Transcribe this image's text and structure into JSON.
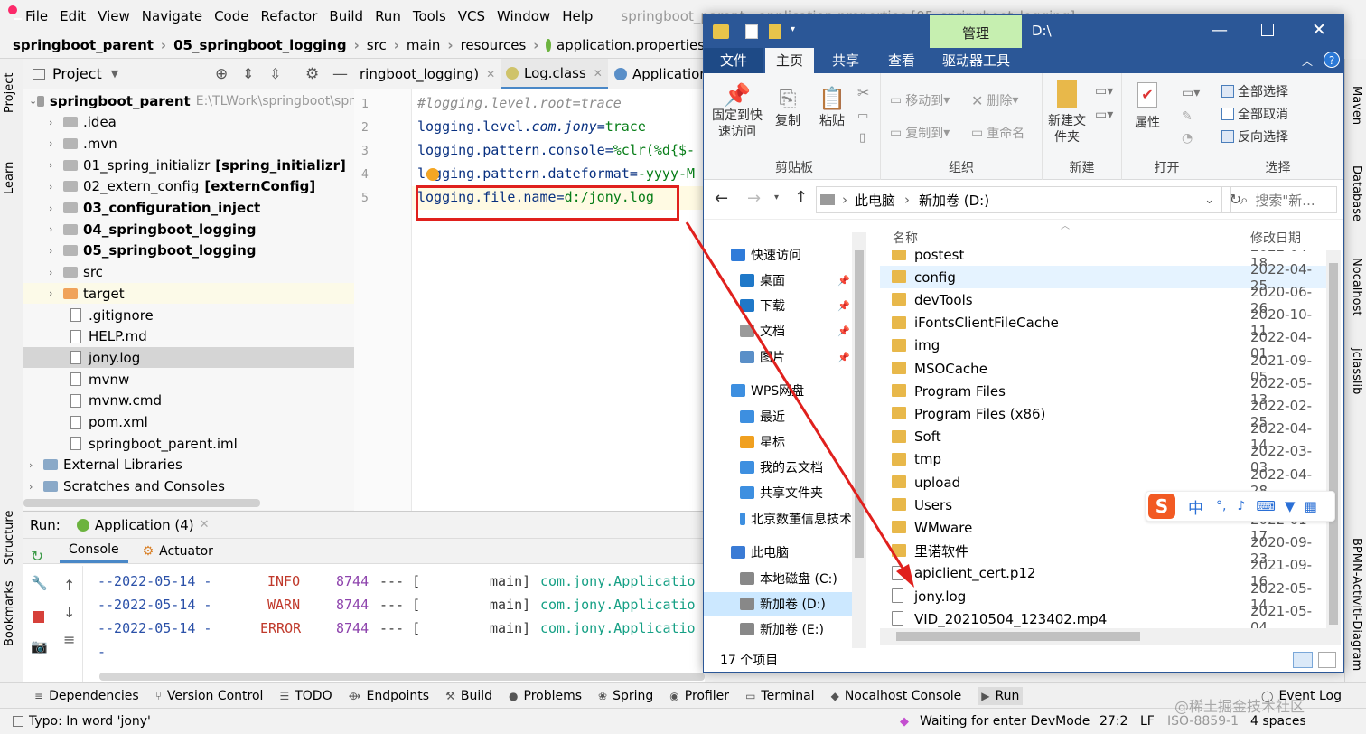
{
  "ide": {
    "menu": [
      "File",
      "Edit",
      "View",
      "Navigate",
      "Code",
      "Refactor",
      "Build",
      "Run",
      "Tools",
      "VCS",
      "Window",
      "Help"
    ],
    "window_title": "springboot_parent - application.properties [05_springboot_logging]",
    "breadcrumb": [
      "springboot_parent",
      "05_springboot_logging",
      "src",
      "main",
      "resources",
      "application.properties"
    ],
    "left_strip": [
      "Project",
      "Learn",
      "Structure",
      "Bookmarks"
    ],
    "right_strip": [
      "Maven",
      "Database",
      "Nocalhost",
      "jclasslib",
      "BPMN-Activiti-Diagram"
    ],
    "project_header": "Project",
    "tree": [
      {
        "label": "springboot_parent",
        "suffix": "E:\\TLWork\\springboot\\spr",
        "indent": 0,
        "bold": true,
        "type": "module",
        "open": true
      },
      {
        "label": ".idea",
        "indent": 1,
        "type": "folder"
      },
      {
        "label": ".mvn",
        "indent": 1,
        "type": "folder"
      },
      {
        "label": "01_spring_initializr",
        "suffix": "[spring_initializr]",
        "indent": 1,
        "type": "folder"
      },
      {
        "label": "02_extern_config",
        "suffix": "[externConfig]",
        "indent": 1,
        "type": "folder"
      },
      {
        "label": "03_configuration_inject",
        "indent": 1,
        "bold": true,
        "type": "folder"
      },
      {
        "label": "04_springboot_logging",
        "indent": 1,
        "bold": true,
        "type": "folder"
      },
      {
        "label": "05_springboot_logging",
        "indent": 1,
        "bold": true,
        "type": "folder"
      },
      {
        "label": "src",
        "indent": 1,
        "type": "folder"
      },
      {
        "label": "target",
        "indent": 1,
        "type": "folder-orange"
      },
      {
        "label": ".gitignore",
        "indent": 1,
        "type": "file"
      },
      {
        "label": "HELP.md",
        "indent": 1,
        "type": "file"
      },
      {
        "label": "jony.log",
        "indent": 1,
        "type": "file",
        "selected": true
      },
      {
        "label": "mvnw",
        "indent": 1,
        "type": "file"
      },
      {
        "label": "mvnw.cmd",
        "indent": 1,
        "type": "file"
      },
      {
        "label": "pom.xml",
        "indent": 1,
        "type": "file"
      },
      {
        "label": "springboot_parent.iml",
        "indent": 1,
        "type": "file"
      },
      {
        "label": "External Libraries",
        "indent": 0,
        "type": "lib"
      },
      {
        "label": "Scratches and Consoles",
        "indent": 0,
        "type": "lib"
      }
    ],
    "editor_tabs": [
      "ringboot_logging)",
      "Log.class",
      "Application"
    ],
    "code_lines": [
      {
        "n": "1",
        "text": "#logging.level.root=trace",
        "kind": "comment"
      },
      {
        "n": "2",
        "key": "logging.level.",
        "key_italic": "com.jony",
        "value": "trace"
      },
      {
        "n": "3",
        "key": "logging.pattern.console",
        "value": "%clr(%d{$-"
      },
      {
        "n": "4",
        "key": "logging.pattern.dateformat",
        "value": "-yyyy-M"
      },
      {
        "n": "5",
        "key": "logging.file.name",
        "value": "d:/jony.log"
      }
    ],
    "run": {
      "label": "Run:",
      "tab": "Application (4)",
      "subtabs": [
        "Console",
        "Actuator"
      ],
      "logs": [
        {
          "date": "--2022-05-14 -",
          "level": "INFO",
          "pid": "8744",
          "sep": "--- [",
          "thread": "main]",
          "logger": "com.jony.Applicatio"
        },
        {
          "date": "--2022-05-14 -",
          "level": "WARN",
          "pid": "8744",
          "sep": "--- [",
          "thread": "main]",
          "logger": "com.jony.Applicatio"
        },
        {
          "date": "--2022-05-14 -",
          "level": "ERROR",
          "pid": "8744",
          "sep": "--- [",
          "thread": "main]",
          "logger": "com.jony.Applicatio"
        },
        {
          "date": "-"
        }
      ]
    },
    "tool_windows": [
      "Dependencies",
      "Version Control",
      "TODO",
      "Endpoints",
      "Build",
      "Problems",
      "Spring",
      "Profiler",
      "Terminal",
      "Nocalhost Console",
      "Run",
      "Event Log"
    ],
    "status": {
      "left": "Typo: In word 'jony'",
      "devmode": "Waiting for enter DevMode",
      "pos": "27:2",
      "lf": "LF",
      "encoding": "ISO-8859-1",
      "indent": "4 spaces"
    },
    "watermark": "@稀土掘金技术社区"
  },
  "explorer": {
    "manage_tab": "管理",
    "path_title": "D:\\",
    "tabs": [
      "文件",
      "主页",
      "共享",
      "查看",
      "驱动器工具"
    ],
    "ribbon": {
      "clipboard": {
        "group": "剪贴板",
        "pin": "固定到快速访问",
        "copy": "复制",
        "paste": "粘贴"
      },
      "organize": {
        "group": "组织",
        "move": "移动到",
        "copyto": "复制到",
        "delete": "删除",
        "rename": "重命名"
      },
      "new": {
        "group": "新建",
        "new_folder": "新建文件夹"
      },
      "open": {
        "group": "打开",
        "props": "属性"
      },
      "select": {
        "group": "选择",
        "all": "全部选择",
        "none": "全部取消",
        "invert": "反向选择"
      }
    },
    "address": [
      "此电脑",
      "新加卷 (D:)"
    ],
    "search_placeholder": "搜索\"新...",
    "nav": [
      {
        "label": "快速访问",
        "level": 0,
        "color": "#2f7bd9"
      },
      {
        "label": "桌面",
        "level": 1,
        "color": "#1f78c8",
        "pin": true
      },
      {
        "label": "下载",
        "level": 1,
        "color": "#1f78c8",
        "pin": true
      },
      {
        "label": "文档",
        "level": 1,
        "color": "#9a9a9a",
        "pin": true
      },
      {
        "label": "图片",
        "level": 1,
        "color": "#5a8fc8",
        "pin": true
      },
      {
        "label": "WPS网盘",
        "level": 0,
        "color": "#3d8fe0"
      },
      {
        "label": "最近",
        "level": 1,
        "color": "#3d8fe0"
      },
      {
        "label": "星标",
        "level": 1,
        "color": "#f0a020"
      },
      {
        "label": "我的云文档",
        "level": 1,
        "color": "#3d8fe0"
      },
      {
        "label": "共享文件夹",
        "level": 1,
        "color": "#3d8fe0"
      },
      {
        "label": "北京数董信息技术",
        "level": 1,
        "color": "#3d8fe0"
      },
      {
        "label": "此电脑",
        "level": 0,
        "color": "#3a7bd5"
      },
      {
        "label": "本地磁盘 (C:)",
        "level": 1,
        "color": "#888"
      },
      {
        "label": "新加卷 (D:)",
        "level": 1,
        "color": "#888",
        "selected": true
      },
      {
        "label": "新加卷 (E:)",
        "level": 1,
        "color": "#888"
      }
    ],
    "columns": {
      "name": "名称",
      "date": "修改日期"
    },
    "files": [
      {
        "name": "postest",
        "date": "2022-04-18",
        "type": "folder"
      },
      {
        "name": "config",
        "date": "2022-04-25",
        "type": "folder",
        "selected": true
      },
      {
        "name": "devTools",
        "date": "2020-06-26",
        "type": "folder"
      },
      {
        "name": "iFontsClientFileCache",
        "date": "2020-10-11",
        "type": "folder"
      },
      {
        "name": "img",
        "date": "2022-04-01",
        "type": "folder"
      },
      {
        "name": "MSOCache",
        "date": "2021-09-05",
        "type": "folder"
      },
      {
        "name": "Program Files",
        "date": "2022-05-13",
        "type": "folder"
      },
      {
        "name": "Program Files (x86)",
        "date": "2022-02-25",
        "type": "folder"
      },
      {
        "name": "Soft",
        "date": "2022-04-14",
        "type": "folder"
      },
      {
        "name": "tmp",
        "date": "2022-03-03",
        "type": "folder"
      },
      {
        "name": "upload",
        "date": "2022-04-28",
        "type": "folder"
      },
      {
        "name": "Users",
        "date": "",
        "type": "folder"
      },
      {
        "name": "WMware",
        "date": "2022-01-17",
        "type": "folder"
      },
      {
        "name": "里诺软件",
        "date": "2020-09-23",
        "type": "folder"
      },
      {
        "name": "apiclient_cert.p12",
        "date": "2021-09-16",
        "type": "doc"
      },
      {
        "name": "jony.log",
        "date": "2022-05-14",
        "type": "doc"
      },
      {
        "name": "VID_20210504_123402.mp4",
        "date": "2021-05-04",
        "type": "doc"
      }
    ],
    "status": "17 个项目"
  },
  "ime": {
    "glyph": "S",
    "lang": "中",
    "items": [
      "°,",
      "🎤",
      "⌨",
      "👕",
      "▦"
    ]
  },
  "colors": {
    "explorer_blue": "#2b5797",
    "annotation_red": "#e0201d",
    "manage_green": "#c6efb0"
  }
}
